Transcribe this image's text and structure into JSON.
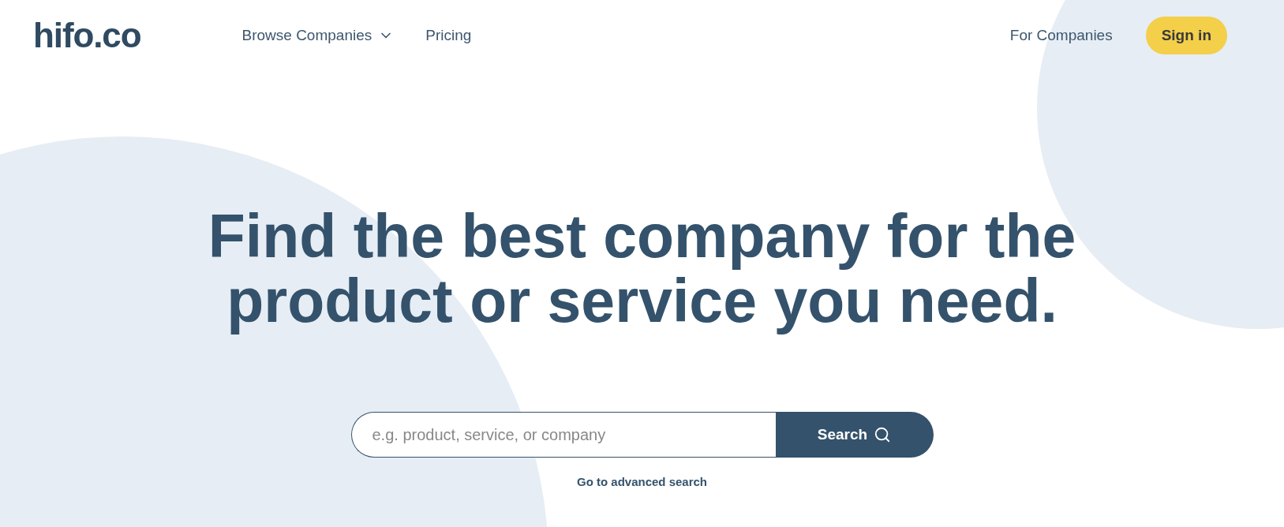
{
  "logo": "hifo.co",
  "nav": [
    {
      "label": "Browse Companies",
      "has_menu": true
    },
    {
      "label": "Pricing",
      "has_menu": false
    }
  ],
  "nav_right": {
    "link": "For Companies",
    "button": "Sign in"
  },
  "hero": {
    "heading": "Find the best company for the product or service you need."
  },
  "search": {
    "placeholder": "e.g. product, service, or company",
    "button": "Search",
    "advanced_link": "Go to advanced search"
  }
}
